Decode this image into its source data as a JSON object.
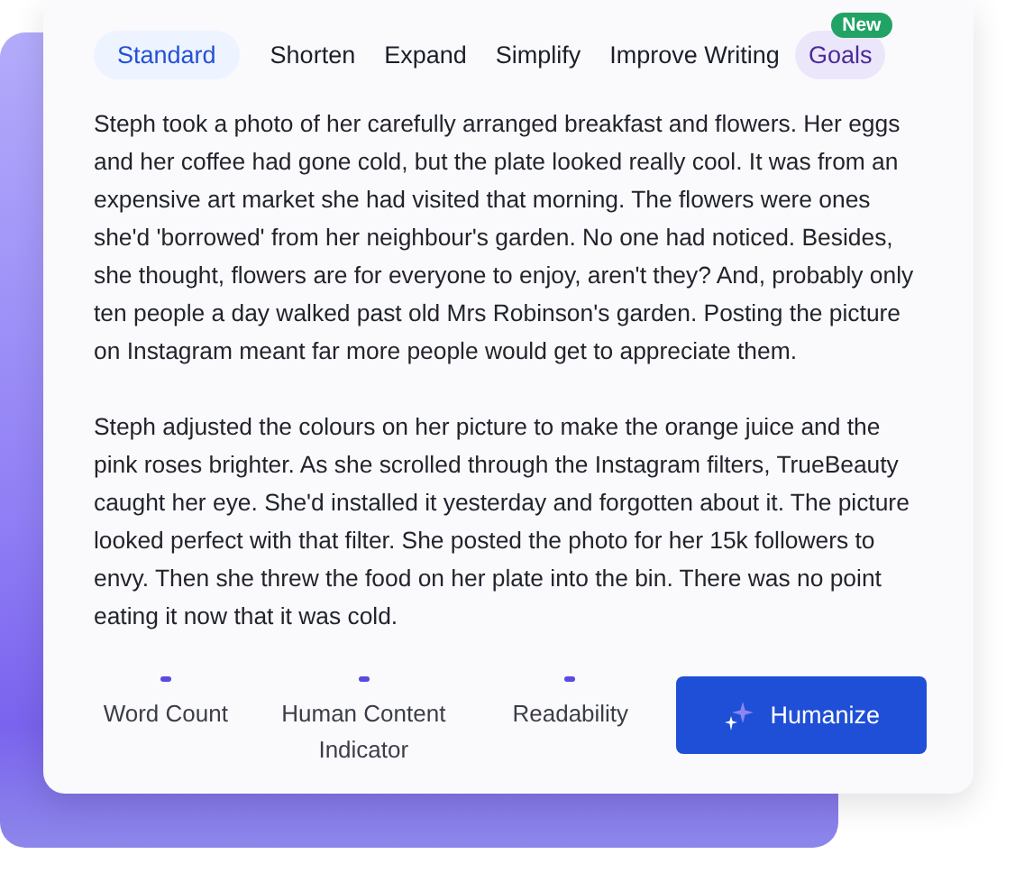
{
  "tabs": [
    {
      "label": "Standard",
      "selected": true,
      "kind": "mode"
    },
    {
      "label": "Shorten",
      "selected": false,
      "kind": "mode"
    },
    {
      "label": "Expand",
      "selected": false,
      "kind": "mode"
    },
    {
      "label": "Simplify",
      "selected": false,
      "kind": "mode"
    },
    {
      "label": "Improve Writing",
      "selected": false,
      "kind": "mode"
    },
    {
      "label": "Goals",
      "selected": false,
      "kind": "feature",
      "badge": "New"
    }
  ],
  "paragraphs": [
    "Steph took a photo of her carefully arranged breakfast and flowers. Her eggs and her coffee had gone cold, but the plate looked really cool. It was from an expensive art market she had visited that morning. The flowers were ones she'd 'borrowed' from her neighbour's garden. No one had noticed. Besides, she thought, flowers are for everyone to enjoy, aren't they? And, probably only ten people a day walked past old Mrs Robinson's garden. Posting the picture on Instagram meant far more people would get to appreciate them.",
    "Steph adjusted the colours on her picture to make the orange juice and the pink roses brighter. As she scrolled through the Instagram filters, TrueBeauty caught her eye. She'd installed it yesterday and forgotten about it. The picture looked perfect with that filter. She posted the photo for her 15k followers to envy. Then she threw the food on her plate into the bin. There was no point eating it now that it was cold."
  ],
  "metrics": [
    {
      "label": "Word Count"
    },
    {
      "label": "Human Content Indicator"
    },
    {
      "label": "Readability"
    }
  ],
  "action_button": {
    "label": "Humanize"
  }
}
